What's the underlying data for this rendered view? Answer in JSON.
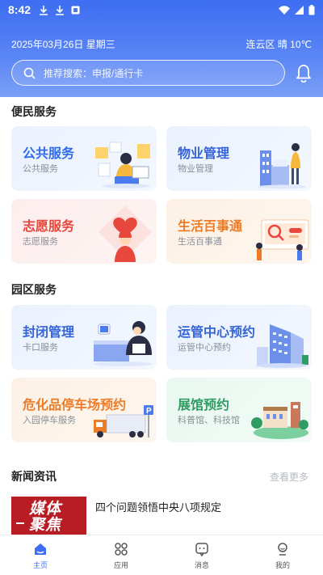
{
  "status": {
    "time": "8:42"
  },
  "header": {
    "date": "2025年03月26日  星期三",
    "weather": "连云区 晴 10℃",
    "search_placeholder": "推荐搜索：申报/通行卡"
  },
  "sections": {
    "civil": {
      "title": "便民服务",
      "cards": [
        {
          "title": "公共服务",
          "subtitle": "公共服务"
        },
        {
          "title": "物业管理",
          "subtitle": "物业管理"
        },
        {
          "title": "志愿服务",
          "subtitle": "志愿服务"
        },
        {
          "title": "生活百事通",
          "subtitle": "生活百事通"
        }
      ]
    },
    "park": {
      "title": "园区服务",
      "cards": [
        {
          "title": "封闭管理",
          "subtitle": "卡口服务"
        },
        {
          "title": "运管中心预约",
          "subtitle": "运管中心预约"
        },
        {
          "title": "危化品停车场预约",
          "subtitle": "入园停车服务"
        },
        {
          "title": "展馆预约",
          "subtitle": "科普馆、科技馆"
        }
      ]
    },
    "news": {
      "title": "新闻资讯",
      "more": "查看更多",
      "thumb_text": "媒体\n聚焦",
      "items": [
        {
          "title": "四个问题领悟中央八项规定"
        }
      ]
    }
  },
  "tabs": [
    {
      "label": "主页",
      "icon": "home-icon",
      "active": true
    },
    {
      "label": "应用",
      "icon": "apps-icon",
      "active": false
    },
    {
      "label": "消息",
      "icon": "message-icon",
      "active": false
    },
    {
      "label": "我的",
      "icon": "profile-icon",
      "active": false
    }
  ],
  "colors": {
    "primary": "#3d6df2",
    "red": "#e8473e",
    "orange": "#ee7b25",
    "green": "#2e9c63"
  }
}
